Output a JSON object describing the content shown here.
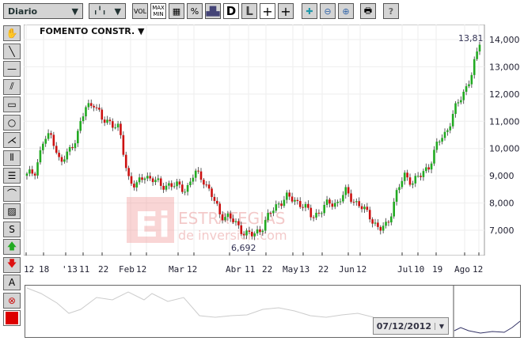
{
  "toolbar": {
    "period": "Diario",
    "vol": "VOL",
    "max": "MAX",
    "min": "MIN",
    "pct": "%",
    "d": "D",
    "l": "L",
    "help": "?"
  },
  "chart": {
    "title": "FOMENTO CONSTR. ▼",
    "last_label": "13,81",
    "low_label": "6,692",
    "watermark_logo": "Ei",
    "watermark_1": "ESTRATEGIAS",
    "watermark_2": "de inversion.com"
  },
  "chart_data": {
    "type": "candlestick",
    "ylim": [
      6200,
      14500
    ],
    "yticks": [
      "7,000",
      "8,000",
      "9,000",
      "10,000",
      "11,000",
      "12,000",
      "13,000",
      "14,000"
    ],
    "ytick_values": [
      7000,
      8000,
      9000,
      10000,
      11000,
      12000,
      13000,
      14000
    ],
    "xticks": [
      "12",
      "18",
      "'13",
      "11",
      "22",
      "Feb",
      "12",
      "Mar",
      "12",
      "Abr",
      "11",
      "22",
      "May",
      "13",
      "22",
      "Jun",
      "12",
      "Jul",
      "10",
      "19",
      "Ago",
      "12"
    ],
    "closes": [
      9000,
      9200,
      10300,
      10500,
      9400,
      9900,
      10500,
      11500,
      11700,
      11000,
      11000,
      10700,
      9000,
      8600,
      9000,
      8900,
      8600,
      8700,
      8600,
      8500,
      9100,
      8900,
      8300,
      7600,
      7500,
      7200,
      6900,
      6800,
      7100,
      7600,
      8000,
      8200,
      8100,
      7900,
      7500,
      7700,
      8000,
      8000,
      8400,
      8100,
      7800,
      7500,
      7000,
      7200,
      8300,
      9000,
      8800,
      9000,
      9400,
      10200,
      10600,
      11400,
      12000,
      12700,
      13810
    ]
  },
  "navigator": {
    "date": "07/12/2012"
  },
  "colors": {
    "up": "#22aa22",
    "down": "#cc1111",
    "grid": "#dddddd"
  }
}
